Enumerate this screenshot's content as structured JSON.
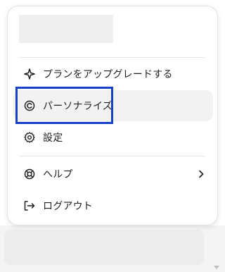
{
  "menu": {
    "items": [
      {
        "label": "プランをアップグレードする",
        "icon": "sparkle-icon"
      },
      {
        "label": "パーソナライズ",
        "icon": "personalize-icon"
      },
      {
        "label": "設定",
        "icon": "gear-icon"
      },
      {
        "label": "ヘルプ",
        "icon": "lifebuoy-icon",
        "has_submenu": true
      },
      {
        "label": "ログアウト",
        "icon": "logout-icon"
      }
    ],
    "highlight_color": "#1740c9",
    "hover_color": "#f2f2f2"
  }
}
